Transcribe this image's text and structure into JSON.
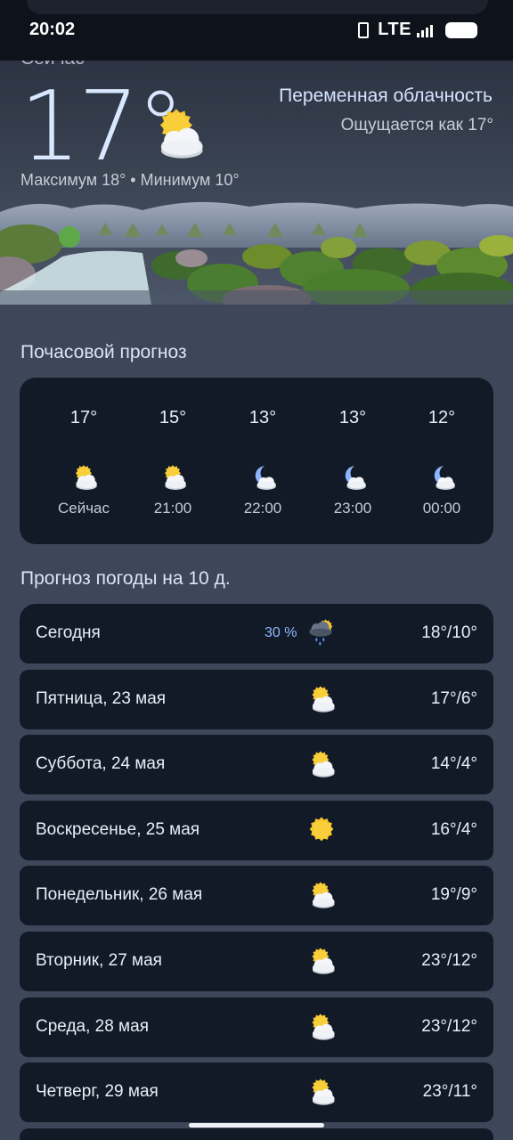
{
  "status_bar": {
    "time": "20:02",
    "network": "LTE"
  },
  "current": {
    "label": "Сейчас",
    "temperature": "17°",
    "condition": "Переменная облачность",
    "feels_like": "Ощущается как 17°",
    "max_min": "Максимум 18° • Минимум 10°",
    "icon": "partly-cloudy-day-icon"
  },
  "hourly": {
    "title": "Почасовой прогноз",
    "items": [
      {
        "temp": "17°",
        "time": "Сейчас",
        "icon": "partly-cloudy-day-icon"
      },
      {
        "temp": "15°",
        "time": "21:00",
        "icon": "partly-cloudy-day-icon"
      },
      {
        "temp": "13°",
        "time": "22:00",
        "icon": "partly-cloudy-night-icon"
      },
      {
        "temp": "13°",
        "time": "23:00",
        "icon": "partly-cloudy-night-icon"
      },
      {
        "temp": "12°",
        "time": "00:00",
        "icon": "partly-cloudy-night-icon"
      }
    ]
  },
  "daily": {
    "title": "Прогноз погоды на 10 д.",
    "items": [
      {
        "day": "Сегодня",
        "precip": "30 %",
        "temps": "18°/10°",
        "icon": "rain-cloud-icon"
      },
      {
        "day": "Пятница, 23 мая",
        "temps": "17°/6°",
        "icon": "partly-cloudy-day-icon"
      },
      {
        "day": "Суббота, 24 мая",
        "temps": "14°/4°",
        "icon": "partly-cloudy-day-icon"
      },
      {
        "day": "Воскресенье, 25 мая",
        "temps": "16°/4°",
        "icon": "sun-icon"
      },
      {
        "day": "Понедельник, 26 мая",
        "temps": "19°/9°",
        "icon": "partly-cloudy-day-icon"
      },
      {
        "day": "Вторник, 27 мая",
        "temps": "23°/12°",
        "icon": "partly-cloudy-day-icon"
      },
      {
        "day": "Среда, 28 мая",
        "temps": "23°/12°",
        "icon": "partly-cloudy-day-icon"
      },
      {
        "day": "Четверг, 29 мая",
        "temps": "23°/11°",
        "icon": "partly-cloudy-day-icon"
      }
    ]
  },
  "colors": {
    "background": "#3d4759",
    "card": "#121a27",
    "sun": "#f6c630",
    "moon": "#8db4ff",
    "precip_text": "#8cb8ff"
  }
}
